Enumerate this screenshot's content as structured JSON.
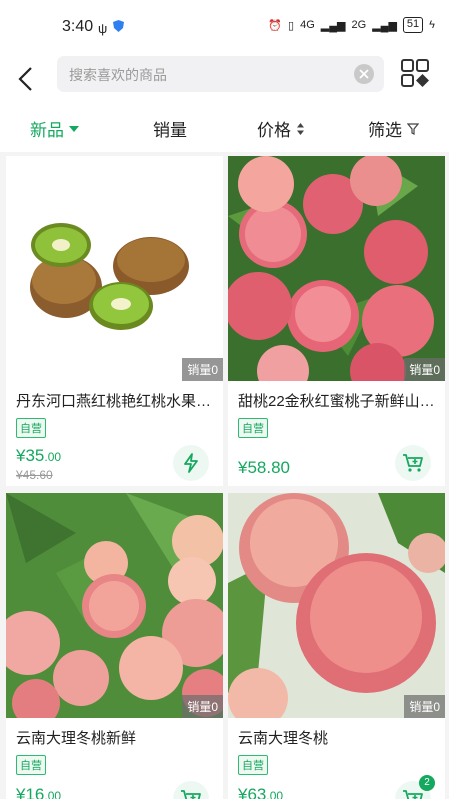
{
  "status_bar": {
    "time": "3:40",
    "signal_1": "4G",
    "signal_2": "2G",
    "battery": "51"
  },
  "search": {
    "placeholder": "搜索喜欢的商品"
  },
  "sort_tabs": [
    {
      "label": "新品",
      "active": true
    },
    {
      "label": "销量",
      "active": false
    },
    {
      "label": "价格",
      "active": false
    },
    {
      "label": "筛选",
      "active": false
    }
  ],
  "products": [
    {
      "title": "丹东河口燕红桃艳红桃水果…",
      "sales": "销量0",
      "tag": "自营",
      "price": "¥35",
      "price_decimal": ".00",
      "original_price": "¥45.60",
      "action_icon": "flash-icon"
    },
    {
      "title": "甜桃22金秋红蜜桃子新鲜山…",
      "sales": "销量0",
      "tag": "自营",
      "price": "¥58.80",
      "price_decimal": "",
      "original_price": "",
      "action_icon": "cart-icon"
    },
    {
      "title": "云南大理冬桃新鲜",
      "sales": "销量0",
      "tag": "自营",
      "price": "¥16",
      "price_decimal": ".00",
      "original_price": "",
      "action_icon": "cart-icon"
    },
    {
      "title": "云南大理冬桃",
      "sales": "销量0",
      "tag": "自营",
      "price": "¥63",
      "price_decimal": ".00",
      "original_price": "",
      "action_icon": "cart-icon",
      "badge": "2"
    }
  ],
  "colors": {
    "accent": "#15a85f",
    "background": "#f4f4f4"
  }
}
